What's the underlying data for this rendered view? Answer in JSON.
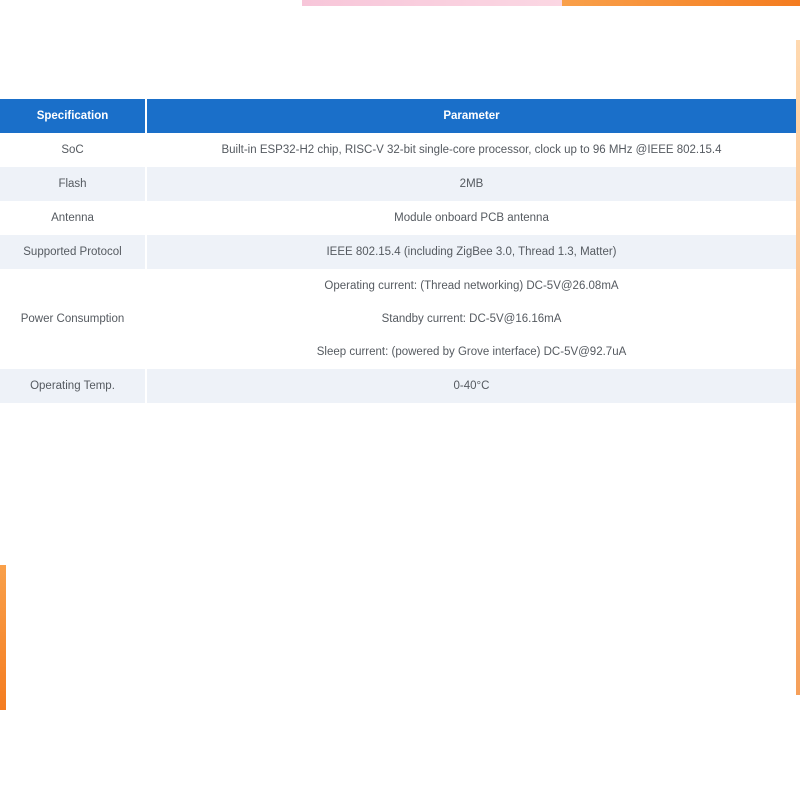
{
  "table": {
    "headers": [
      "Specification",
      "Parameter"
    ],
    "rows": [
      {
        "spec": "SoC",
        "params": [
          "Built-in ESP32-H2 chip, RISC-V 32-bit single-core processor, clock up to 96 MHz @IEEE 802.15.4"
        ]
      },
      {
        "spec": "Flash",
        "params": [
          "2MB"
        ]
      },
      {
        "spec": "Antenna",
        "params": [
          "Module onboard PCB antenna"
        ]
      },
      {
        "spec": "Supported Protocol",
        "params": [
          "IEEE 802.15.4 (including ZigBee 3.0, Thread 1.3, Matter)"
        ]
      },
      {
        "spec": "Power Consumption",
        "params": [
          "Operating current: (Thread networking) DC-5V@26.08mA",
          "Standby current: DC-5V@16.16mA",
          "Sleep current: (powered by Grove interface) DC-5V@92.7uA"
        ]
      },
      {
        "spec": "Operating Temp.",
        "params": [
          "0-40°C"
        ]
      }
    ]
  },
  "colors": {
    "header_bg": "#1a6fc9",
    "header_text": "#ffffff",
    "row_alt_bg": "#eef2f8",
    "body_text": "#555a60"
  }
}
